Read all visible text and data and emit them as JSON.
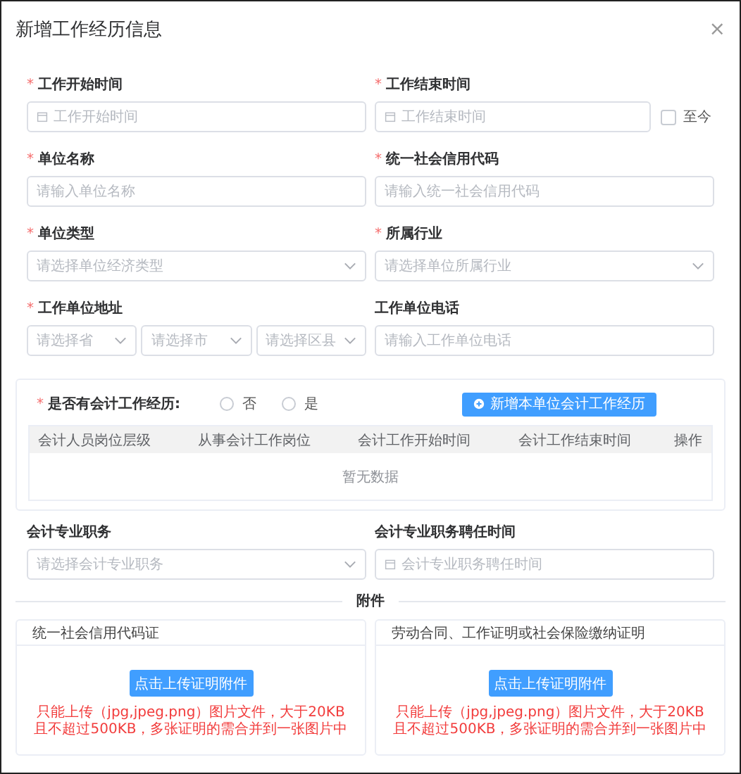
{
  "dialog": {
    "title": "新增工作经历信息",
    "close": "×"
  },
  "fields": [
    {
      "kind": "date",
      "label": "工作开始时间",
      "required_mark": "*",
      "placeholder": "工作开始时间"
    },
    {
      "kind": "date",
      "label": "工作结束时间",
      "required_mark": "*",
      "placeholder": "工作结束时间",
      "now_checkbox": {
        "label": "至今",
        "checked": false
      }
    },
    {
      "kind": "input",
      "label": "单位名称",
      "required_mark": "*",
      "placeholder": "请输入单位名称"
    },
    {
      "kind": "input",
      "label": "统一社会信用代码",
      "required_mark": "*",
      "placeholder": "请输入统一社会信用代码"
    },
    {
      "kind": "select",
      "label": "单位类型",
      "required_mark": "*",
      "placeholder": "请选择单位经济类型"
    },
    {
      "kind": "select",
      "label": "所属行业",
      "required_mark": "*",
      "placeholder": "请选择单位所属行业"
    },
    {
      "kind": "region",
      "label": "工作单位地址",
      "required_mark": "*",
      "parts": [
        "请选择省",
        "请选择市",
        "请选择区县"
      ]
    },
    {
      "kind": "input",
      "label": "工作单位电话",
      "placeholder": "请输入工作单位电话"
    }
  ],
  "accounting": {
    "label": "是否有会计工作经历:",
    "required_mark": "*",
    "options": [
      {
        "label": "否",
        "selected": false
      },
      {
        "label": "是",
        "selected": false
      }
    ],
    "add_button": "新增本单位会计工作经历",
    "table": {
      "columns": [
        "会计人员岗位层级",
        "从事会计工作岗位",
        "会计工作开始时间",
        "会计工作结束时间",
        "操作"
      ],
      "empty_text": "暂无数据"
    }
  },
  "fields_after": [
    {
      "kind": "select",
      "label": "会计专业职务",
      "placeholder": "请选择会计专业职务"
    },
    {
      "kind": "date",
      "label": "会计专业职务聘任时间",
      "placeholder": "会计专业职务聘任时间"
    }
  ],
  "attachments": {
    "title": "附件",
    "cards": [
      {
        "title": "统一社会信用代码证",
        "button": "点击上传证明附件",
        "hint": "只能上传（jpg,jpeg.png）图片文件，大于20KB且不超过500KB，多张证明的需合并到一张图片中"
      },
      {
        "title": "劳动合同、工作证明或社会保险缴纳证明",
        "button": "点击上传证明附件",
        "hint": "只能上传（jpg,jpeg.png）图片文件，大于20KB且不超过500KB，多张证明的需合并到一张图片中"
      }
    ]
  }
}
